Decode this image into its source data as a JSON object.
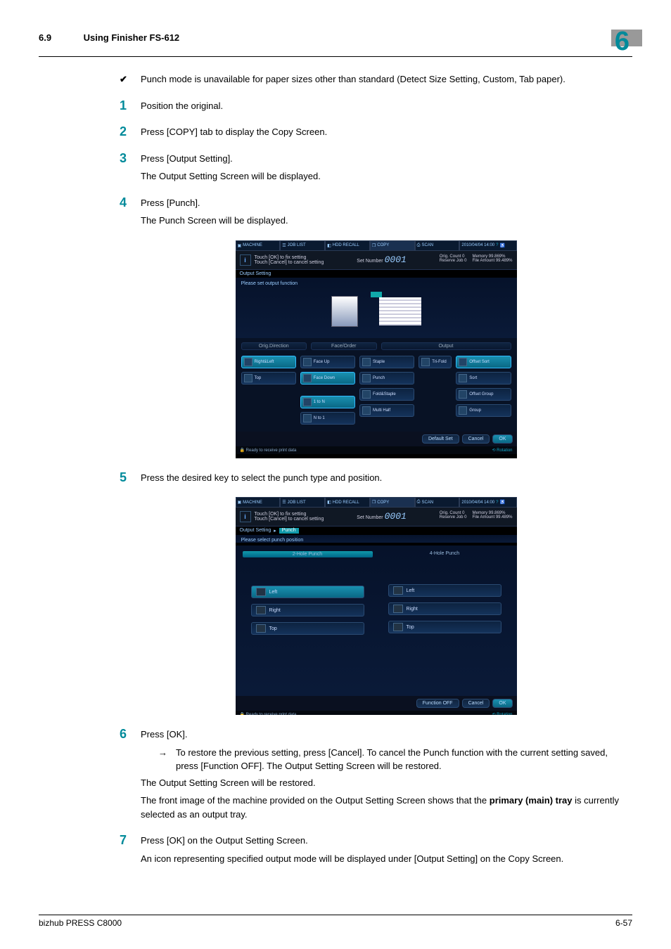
{
  "header": {
    "section_number": "6.9",
    "section_title": "Using Finisher FS-612",
    "chapter_number": "6"
  },
  "bullet": {
    "text": "Punch mode is unavailable for paper sizes other than standard (Detect Size Setting, Custom, Tab paper)."
  },
  "steps": {
    "s1": {
      "num": "1",
      "text": "Position the original."
    },
    "s2": {
      "num": "2",
      "text": "Press [COPY] tab to display the Copy Screen."
    },
    "s3": {
      "num": "3",
      "text": "Press [Output Setting].",
      "text2": "The Output Setting Screen will be displayed."
    },
    "s4": {
      "num": "4",
      "text": "Press [Punch].",
      "text2": "The Punch Screen will be displayed."
    },
    "s5": {
      "num": "5",
      "text": "Press the desired key to select the punch type and position."
    },
    "s6": {
      "num": "6",
      "text": "Press [OK].",
      "sub": "To restore the previous setting, press [Cancel]. To cancel the Punch function with the current setting saved, press [Function OFF]. The Output Setting Screen will be restored.",
      "a1": "The Output Setting Screen will be restored.",
      "a2a": "The front image of the machine provided on the Output Setting Screen shows that the ",
      "a2b": "primary (main) tray",
      "a2c": " is currently selected as an output tray."
    },
    "s7": {
      "num": "7",
      "text": "Press [OK] on the Output Setting Screen.",
      "text2": "An icon representing specified output mode will be displayed under [Output Setting] on the Copy Screen."
    }
  },
  "screenshot1": {
    "tabs": [
      "MACHINE",
      "JOB LIST",
      "HDD RECALL",
      "COPY",
      "SCAN"
    ],
    "datetime": "2010/04/04 14:00",
    "info_line1": "Touch [OK] to fix setting",
    "info_line2": "Touch [Cancel] to cancel setting",
    "set_number_label": "Set Number",
    "set_number_value": "0001",
    "status": {
      "orig_count": "Orig. Count",
      "orig_count_v": "0",
      "reserve_job": "Reserve Job",
      "reserve_job_v": "0",
      "memory": "Memory",
      "memory_v": "99.869%",
      "file_amount": "File Amount",
      "file_amount_v": "99.489%"
    },
    "breadcrumb": "Output Setting",
    "prompt": "Please set output function",
    "group_headers": [
      "Orig.Direction",
      "Face/Order",
      "",
      "Output"
    ],
    "col1": [
      "Right&Left",
      "Top"
    ],
    "col2": [
      "Face Up",
      "Face Down",
      "1 to N",
      "N to 1"
    ],
    "col3": [
      "Staple",
      "Punch",
      "Fold&Staple",
      "Multi Half"
    ],
    "col3b": [
      "Tri-Fold"
    ],
    "col4": [
      "Offset Sort",
      "Sort",
      "Offset Group",
      "Group"
    ],
    "footer_buttons": [
      "Default Set",
      "Cancel",
      "OK"
    ],
    "statusbar": "Ready to receive print data",
    "rotation": "Rotation"
  },
  "screenshot2": {
    "breadcrumb1": "Output Setting",
    "breadcrumb2": "Punch",
    "prompt": "Please select punch position",
    "col_headers": [
      "2-Hole Punch",
      "4-Hole Punch"
    ],
    "options": [
      "Left",
      "Right",
      "Top"
    ],
    "footer_buttons": [
      "Function OFF",
      "Cancel",
      "OK"
    ]
  },
  "footer": {
    "product": "bizhub PRESS C8000",
    "page": "6-57"
  }
}
